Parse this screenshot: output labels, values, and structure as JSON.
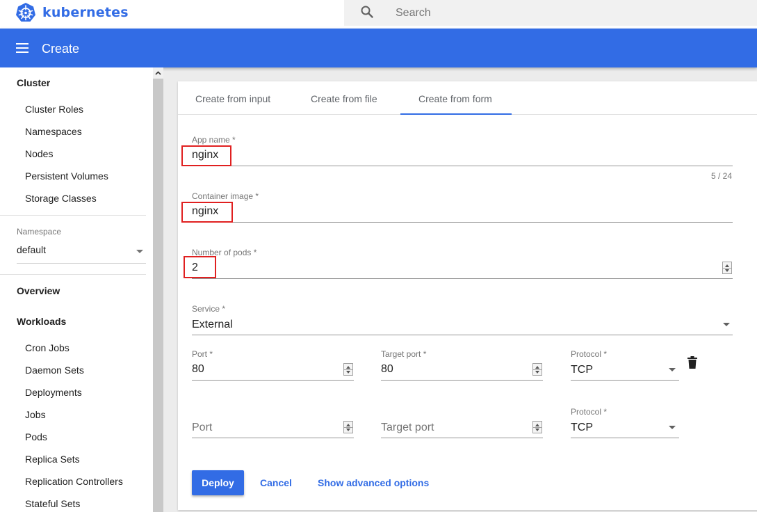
{
  "brand": {
    "name": "kubernetes"
  },
  "search": {
    "placeholder": "Search"
  },
  "appbar": {
    "title": "Create"
  },
  "sidebar": {
    "cluster_heading": "Cluster",
    "cluster_items": [
      "Cluster Roles",
      "Namespaces",
      "Nodes",
      "Persistent Volumes",
      "Storage Classes"
    ],
    "namespace_label": "Namespace",
    "namespace_value": "default",
    "overview": "Overview",
    "workloads_heading": "Workloads",
    "workload_items": [
      "Cron Jobs",
      "Daemon Sets",
      "Deployments",
      "Jobs",
      "Pods",
      "Replica Sets",
      "Replication Controllers",
      "Stateful Sets"
    ]
  },
  "tabs": [
    "Create from input",
    "Create from file",
    "Create from form"
  ],
  "active_tab": "Create from form",
  "form": {
    "app_name": {
      "label": "App name *",
      "value": "nginx",
      "counter": "5 / 24"
    },
    "container_image": {
      "label": "Container image *",
      "value": "nginx"
    },
    "pods": {
      "label": "Number of pods *",
      "value": "2"
    },
    "service": {
      "label": "Service *",
      "value": "External"
    },
    "port_row_1": {
      "port_label": "Port *",
      "port_value": "80",
      "target_label": "Target port *",
      "target_value": "80",
      "protocol_label": "Protocol *",
      "protocol_value": "TCP"
    },
    "port_row_2": {
      "port_placeholder": "Port",
      "target_placeholder": "Target port",
      "protocol_label": "Protocol *",
      "protocol_value": "TCP"
    }
  },
  "actions": {
    "deploy": "Deploy",
    "cancel": "Cancel",
    "advanced": "Show advanced options"
  },
  "colors": {
    "primary": "#326ce5",
    "highlight": "#e02020"
  }
}
